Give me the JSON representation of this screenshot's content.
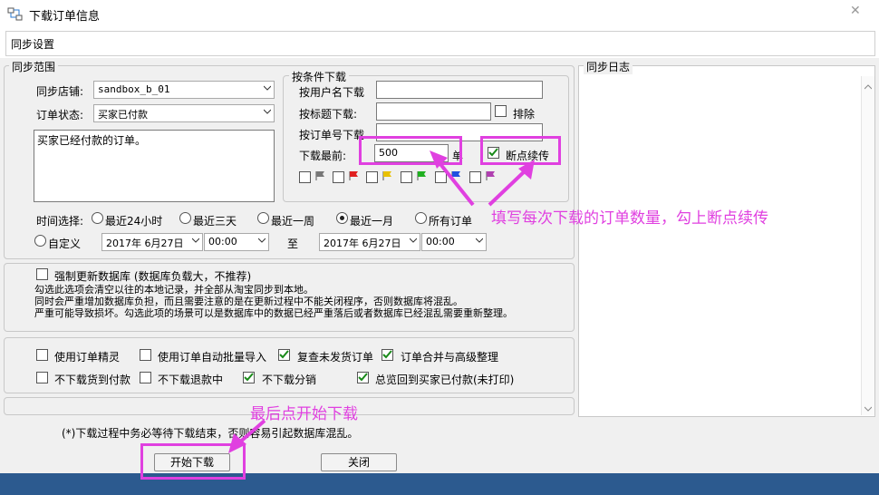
{
  "window": {
    "title": "下载订单信息",
    "close_symbol": "✕"
  },
  "tab": {
    "label": "同步设置"
  },
  "scope": {
    "group_title": "同步范围",
    "store_label": "同步店铺:",
    "store_value": "sandbox_b_01",
    "status_label": "订单状态:",
    "status_value": "买家已付款",
    "description": "买家已经付款的订单。"
  },
  "conditions": {
    "group_title": "按条件下载",
    "by_user": "按用户名下载",
    "by_title": "按标题下载:",
    "exclude": "排除",
    "by_order": "按订单号下载",
    "recent_label": "下载最前:",
    "recent_value": "500",
    "unit": "单",
    "resume": "断点续传",
    "flag_colors": [
      "#777777",
      "#e02020",
      "#e8c000",
      "#20b020",
      "#2050e0",
      "#b040b0"
    ]
  },
  "time": {
    "label": "时间选择:",
    "options": [
      "最近24小时",
      "最近三天",
      "最近一周",
      "最近一月",
      "所有订单"
    ],
    "selected_index": 3,
    "custom": "自定义",
    "start_date": "2017年  6月27日",
    "start_time": "00:00",
    "to": "至",
    "end_date": "2017年  6月27日",
    "end_time": "00:00"
  },
  "force": {
    "label": "强制更新数据库 (数据库负载大，不推荐)",
    "desc1": "勾选此选项会清空以往的本地记录，并全部从淘宝同步到本地。",
    "desc2": "同时会严重增加数据库负担，而且需要注意的是在更新过程中不能关闭程序，否则数据库将混乱。",
    "desc3": "严重可能导致损坏。勾选此项的场景可以是数据库中的数据已经严重落后或者数据库已经混乱需要重新整理。"
  },
  "options": {
    "row1": [
      {
        "label": "使用订单精灵",
        "checked": false
      },
      {
        "label": "使用订单自动批量导入",
        "checked": false
      },
      {
        "label": "复查未发货订单",
        "checked": true
      },
      {
        "label": "订单合并与高级整理",
        "checked": true
      }
    ],
    "row2": [
      {
        "label": "不下载货到付款",
        "checked": false
      },
      {
        "label": "不下载退款中",
        "checked": false
      },
      {
        "label": "不下载分销",
        "checked": true
      },
      {
        "label": "总览回到买家已付款(未打印)",
        "checked": true
      }
    ]
  },
  "note": "(*)下载过程中务必等待下载结束，否则容易引起数据库混乱。",
  "buttons": {
    "start": "开始下载",
    "close": "关闭"
  },
  "log": {
    "title": "同步日志"
  },
  "annotations": {
    "a1": "填写每次下载的订单数量，勾上断点续传",
    "a2": "最后点开始下载",
    "color": "#e040e0"
  }
}
